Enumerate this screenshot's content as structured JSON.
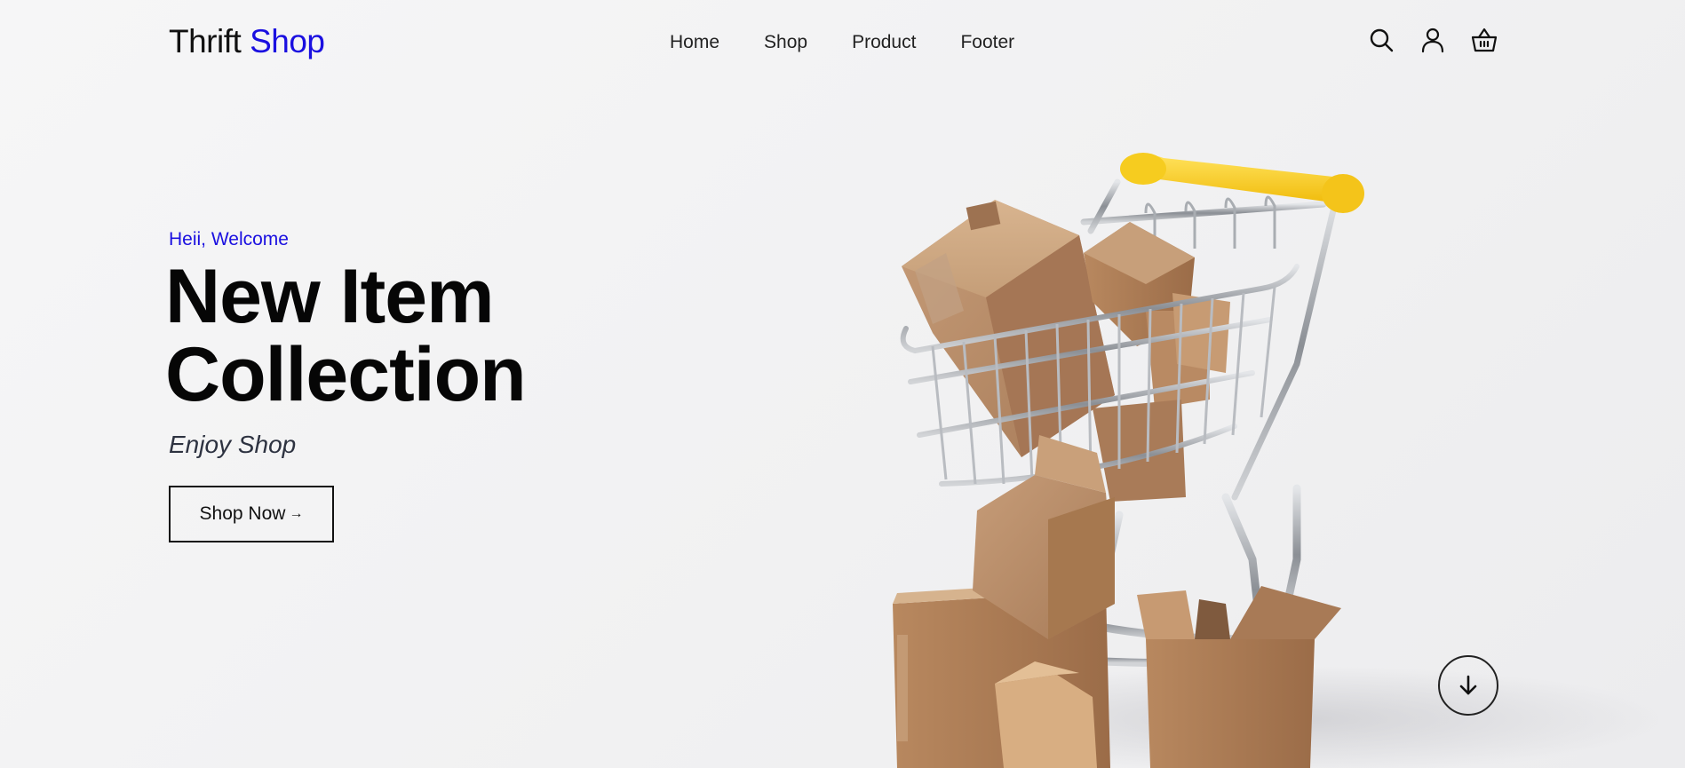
{
  "brand": {
    "name_part1": "Thrift",
    "name_part2": "Shop",
    "accent_color": "#1a0fe0"
  },
  "nav": {
    "items": [
      {
        "label": "Home"
      },
      {
        "label": "Shop"
      },
      {
        "label": "Product"
      },
      {
        "label": "Footer"
      }
    ]
  },
  "header_icons": [
    "search-icon",
    "user-icon",
    "cart-basket-icon"
  ],
  "hero": {
    "greeting": "Heii, Welcome",
    "title_line1": "New Item",
    "title_line2": "Collection",
    "subtitle": "Enjoy Shop",
    "cta_label": "Shop Now",
    "cta_icon": "arrow-right-icon",
    "image": "shopping-cart-with-boxes",
    "scroll_icon": "arrow-down-icon"
  }
}
